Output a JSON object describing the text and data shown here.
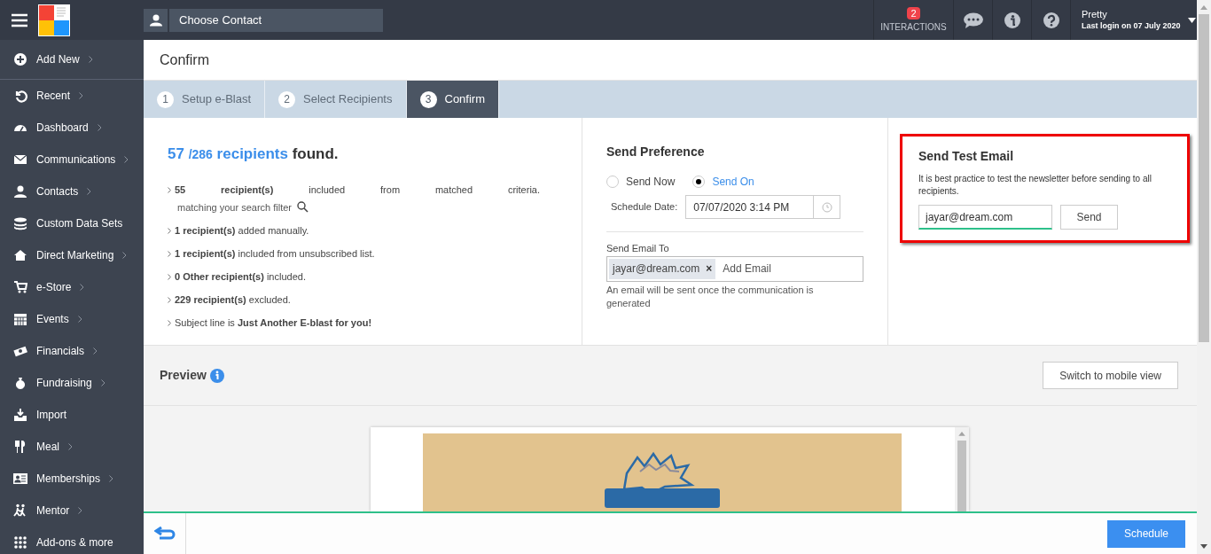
{
  "topbar": {
    "contact_placeholder": "Choose Contact",
    "interactions": {
      "count": "2",
      "label": "INTERACTIONS"
    },
    "user": {
      "name": "Pretty",
      "last_login": "Last login on 07 July 2020"
    }
  },
  "sidebar": {
    "items": [
      {
        "label": "Add New",
        "has_submenu": true
      },
      {
        "label": "Recent",
        "has_submenu": true
      },
      {
        "label": "Dashboard",
        "has_submenu": true
      },
      {
        "label": "Communications",
        "has_submenu": true
      },
      {
        "label": "Contacts",
        "has_submenu": true
      },
      {
        "label": "Custom Data Sets",
        "has_submenu": false
      },
      {
        "label": "Direct Marketing",
        "has_submenu": true
      },
      {
        "label": "e-Store",
        "has_submenu": true
      },
      {
        "label": "Events",
        "has_submenu": true
      },
      {
        "label": "Financials",
        "has_submenu": true
      },
      {
        "label": "Fundraising",
        "has_submenu": true
      },
      {
        "label": "Import",
        "has_submenu": false
      },
      {
        "label": "Meal",
        "has_submenu": true
      },
      {
        "label": "Memberships",
        "has_submenu": true
      },
      {
        "label": "Mentor",
        "has_submenu": true
      },
      {
        "label": "Add-ons & more",
        "has_submenu": false
      }
    ]
  },
  "page_title": "Confirm",
  "steps": [
    {
      "number": "1",
      "label": "Setup e-Blast",
      "selected": false
    },
    {
      "number": "2",
      "label": "Select Recipients",
      "selected": false
    },
    {
      "number": "3",
      "label": "Confirm",
      "selected": true
    }
  ],
  "summary": {
    "count": "57",
    "total": "/286",
    "noun": "recipients",
    "suffix": "found.",
    "items": [
      {
        "text": "**55** **recipient(s)** included from matched criteria.",
        "note": "matching your search filter"
      },
      {
        "text": "**1 recipient(s)** added manually."
      },
      {
        "text": "**1 recipient(s)** included from unsubscribed list."
      },
      {
        "text": "**0 Other recipient(s)** included."
      },
      {
        "text": "**229 recipient(s)** excluded."
      },
      {
        "text": "Subject line is **Just Another E-blast for you!**"
      }
    ]
  },
  "send_preference": {
    "title": "Send Preference",
    "options": [
      {
        "label": "Send Now",
        "selected": false
      },
      {
        "label": "Send On",
        "selected": true
      }
    ],
    "schedule_label": "Schedule Date:",
    "schedule_value": "07/07/2020 3:14 PM",
    "send_to_label": "Send Email To",
    "recipients": [
      "jayar@dream.com"
    ],
    "add_placeholder": "Add Email",
    "remove_glyph": "×",
    "help": "An email will be sent once the communication is generated"
  },
  "test_email": {
    "title": "Send Test Email",
    "description": "It is best practice to test the newsletter before sending to all recipients.",
    "value": "jayar@dream.com",
    "button": "Send",
    "highlighted": true
  },
  "preview": {
    "title": "Preview",
    "button": "Switch to mobile view",
    "kind": "picture"
  },
  "footer": {
    "button": "Schedule"
  }
}
